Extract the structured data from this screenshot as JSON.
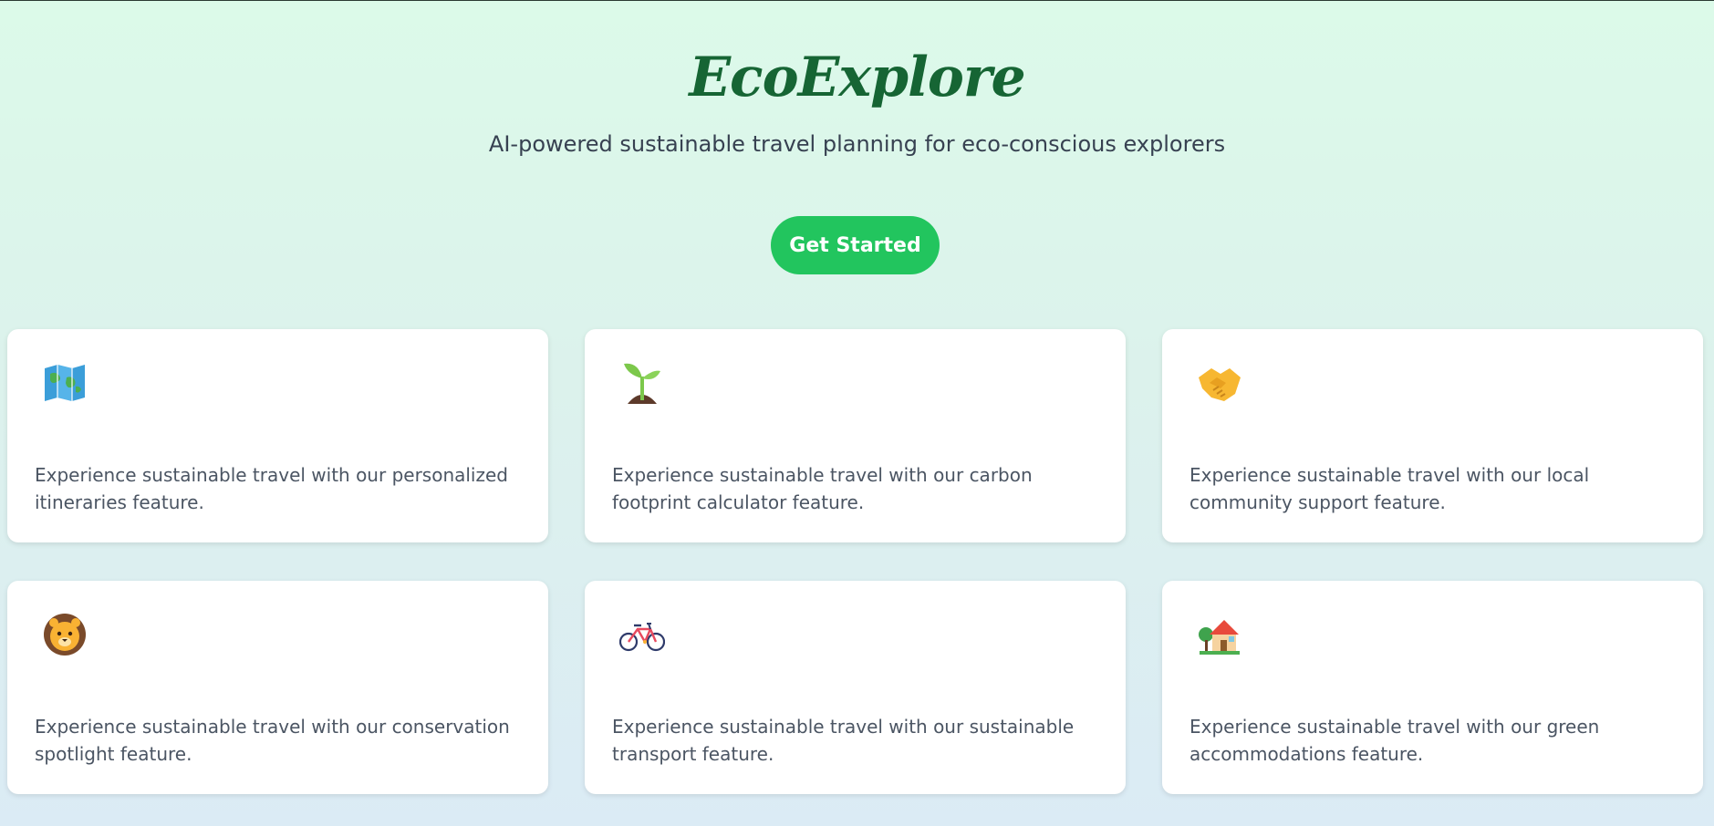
{
  "hero": {
    "title": "EcoExplore",
    "subtitle": "AI-powered sustainable travel planning for eco-conscious explorers",
    "cta_label": "Get Started"
  },
  "colors": {
    "brand_green": "#166534",
    "accent_green": "#22c55e"
  },
  "features": [
    {
      "icon": "map-icon",
      "text": "Experience sustainable travel with our personalized itineraries feature."
    },
    {
      "icon": "seedling-icon",
      "text": "Experience sustainable travel with our carbon footprint calculator feature."
    },
    {
      "icon": "handshake-icon",
      "text": "Experience sustainable travel with our local community support feature."
    },
    {
      "icon": "lion-icon",
      "text": "Experience sustainable travel with our conservation spotlight feature."
    },
    {
      "icon": "bicycle-icon",
      "text": "Experience sustainable travel with our sustainable transport feature."
    },
    {
      "icon": "house-with-garden-icon",
      "text": "Experience sustainable travel with our green accommodations feature."
    }
  ]
}
